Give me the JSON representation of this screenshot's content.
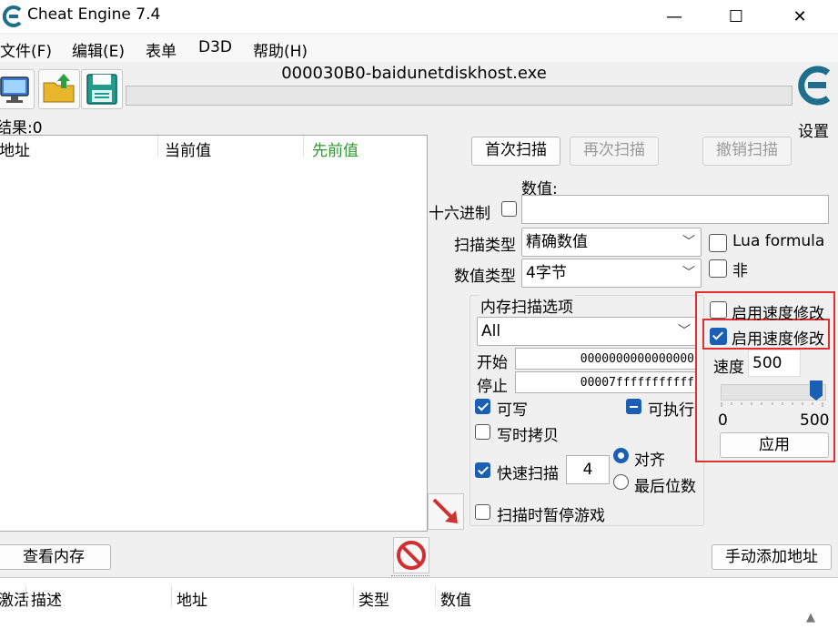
{
  "window": {
    "title": "Cheat Engine 7.4",
    "minimize": "—",
    "maximize": "☐",
    "close": "✕"
  },
  "menu": [
    "文件(F)",
    "编辑(E)",
    "表单",
    "D3D",
    "帮助(H)"
  ],
  "process": {
    "name": "000030B0-baidunetdiskhost.exe"
  },
  "settings_label": "设置",
  "results": {
    "label": "结果:0"
  },
  "found_list": {
    "columns": [
      "地址",
      "当前值",
      "先前值"
    ],
    "prev_color": "#2c9a2c"
  },
  "scan_buttons": {
    "first": "首次扫描",
    "next": "再次扫描",
    "undo": "撤销扫描"
  },
  "value": {
    "label": "数值:",
    "hex_label": "十六进制",
    "current": ""
  },
  "scan_type": {
    "label": "扫描类型",
    "selected": "精确数值"
  },
  "value_type": {
    "label": "数值类型",
    "selected": "4字节"
  },
  "lua_formula": {
    "label": "Lua formula",
    "checked": false
  },
  "not_opt": {
    "label": "非",
    "checked": false
  },
  "memory_options": {
    "title": "内存扫描选项",
    "region": "All",
    "start_label": "开始",
    "start": "0000000000000000",
    "stop_label": "停止",
    "stop": "00007fffffffffff",
    "writable": "可写",
    "executable": "可执行",
    "copy_on_write": "写时拷贝",
    "fast_scan": "快速扫描",
    "fast_scan_value": "4",
    "aligned": "对齐",
    "last_digits": "最后位数",
    "pause_game": "扫描时暂停游戏"
  },
  "speedhack": {
    "enable1": "启用速度修改",
    "enable2": "启用速度修改",
    "speed_label": "速度",
    "speed": "500",
    "slider_min": "0",
    "slider_max": "500",
    "slider_value": 500,
    "apply": "应用"
  },
  "bottom": {
    "view_memory": "查看内存",
    "add_address": "手动添加地址"
  },
  "address_list": {
    "columns": [
      "激活",
      "描述",
      "地址",
      "类型",
      "数值"
    ]
  },
  "colors": {
    "accent": "#1a5fb4",
    "highlight": "#e03030",
    "logo": "#1f6e8c"
  }
}
